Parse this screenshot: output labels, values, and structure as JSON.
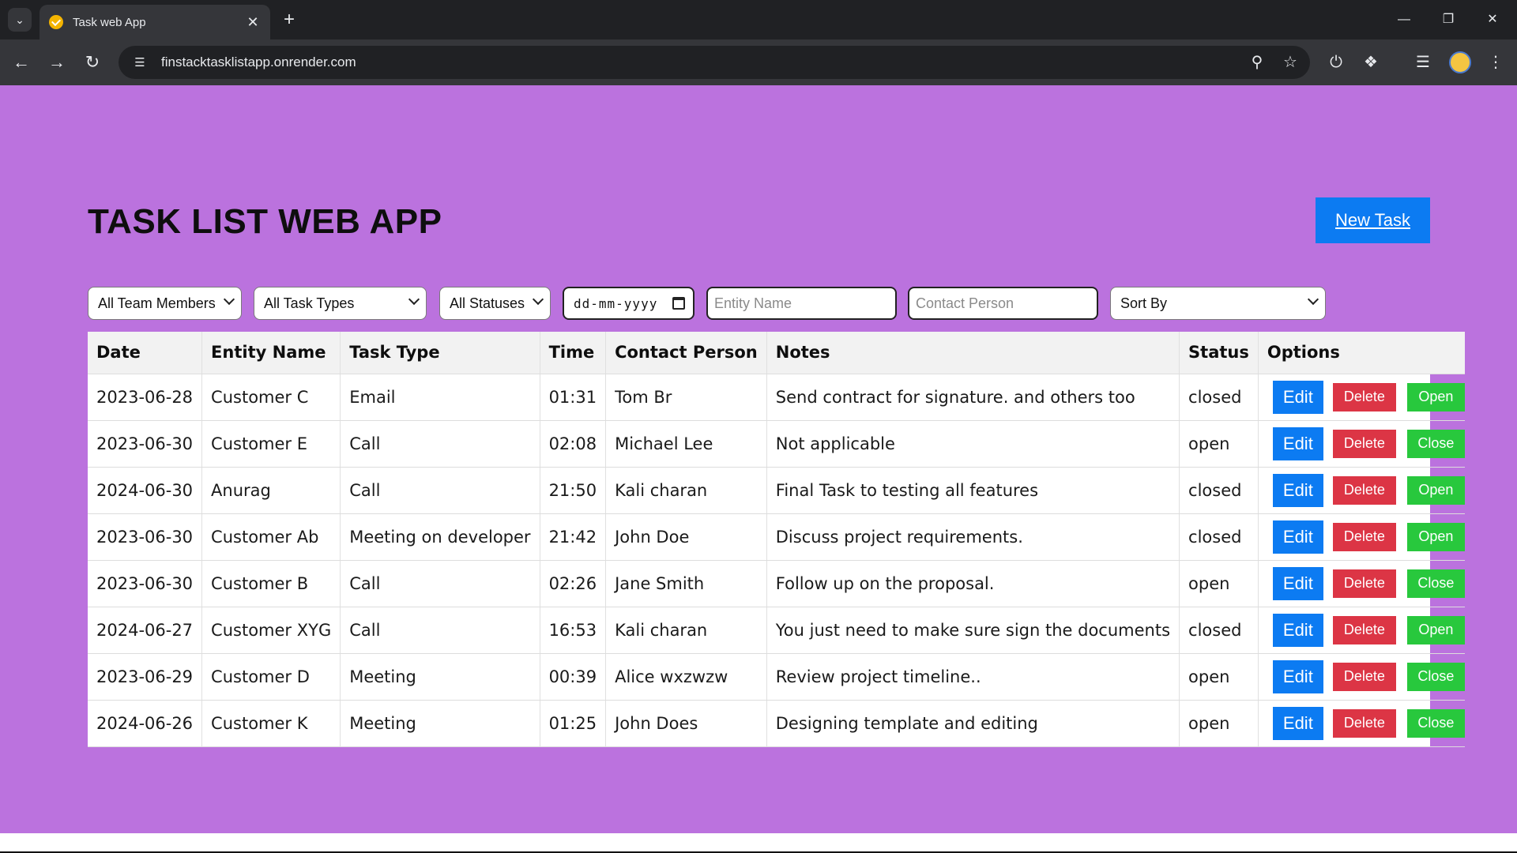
{
  "browser": {
    "tab_title": "Task web App",
    "url": "finstacktasklistapp.onrender.com"
  },
  "page": {
    "title": "TASK LIST WEB APP",
    "new_task_label": "New Task",
    "background_color": "#bb72de"
  },
  "filters": {
    "team_members": "All Team Members",
    "task_types": "All Task Types",
    "statuses": "All Statuses",
    "date_placeholder": "dd-mm-yyyy",
    "entity_name_placeholder": "Entity Name",
    "contact_person_placeholder": "Contact Person",
    "sort_by": "Sort By"
  },
  "table": {
    "headers": [
      "Date",
      "Entity Name",
      "Task Type",
      "Time",
      "Contact Person",
      "Notes",
      "Status",
      "Options"
    ],
    "buttons": {
      "edit": "Edit",
      "delete": "Delete"
    },
    "rows": [
      {
        "date": "2023-06-28",
        "entity": "Customer C",
        "type": "Email",
        "time": "01:31",
        "contact": "Tom Br",
        "notes": "Send contract for signature. and others too",
        "status": "closed",
        "toggle": "Open"
      },
      {
        "date": "2023-06-30",
        "entity": "Customer E",
        "type": "Call",
        "time": "02:08",
        "contact": "Michael Lee",
        "notes": "Not applicable",
        "status": "open",
        "toggle": "Close"
      },
      {
        "date": "2024-06-30",
        "entity": "Anurag",
        "type": "Call",
        "time": "21:50",
        "contact": "Kali charan",
        "notes": "Final Task to testing all features",
        "status": "closed",
        "toggle": "Open"
      },
      {
        "date": "2023-06-30",
        "entity": "Customer Ab",
        "type": "Meeting on developer",
        "time": "21:42",
        "contact": "John Doe",
        "notes": "Discuss project requirements.",
        "status": "closed",
        "toggle": "Open"
      },
      {
        "date": "2023-06-30",
        "entity": "Customer B",
        "type": "Call",
        "time": "02:26",
        "contact": "Jane Smith",
        "notes": "Follow up on the proposal.",
        "status": "open",
        "toggle": "Close"
      },
      {
        "date": "2024-06-27",
        "entity": "Customer XYG",
        "type": "Call",
        "time": "16:53",
        "contact": "Kali charan",
        "notes": "You just need to make sure sign the documents",
        "status": "closed",
        "toggle": "Open"
      },
      {
        "date": "2023-06-29",
        "entity": "Customer D",
        "type": "Meeting",
        "time": "00:39",
        "contact": "Alice wxzwzw",
        "notes": "Review project timeline..",
        "status": "open",
        "toggle": "Close"
      },
      {
        "date": "2024-06-26",
        "entity": "Customer K",
        "type": "Meeting",
        "time": "01:25",
        "contact": "John Does",
        "notes": "Designing template and editing",
        "status": "open",
        "toggle": "Close"
      }
    ]
  },
  "colors": {
    "primary_blue": "#0c7bf2",
    "delete_red": "#dc3545",
    "toggle_green": "#28c83d"
  }
}
